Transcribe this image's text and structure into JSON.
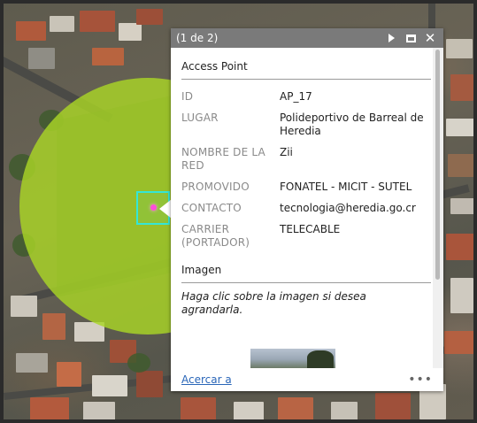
{
  "popup": {
    "count_label": "(1 de 2)",
    "layer_title": "Access Point",
    "fields": [
      {
        "key": "ID",
        "value": "AP_17"
      },
      {
        "key": "LUGAR",
        "value": "Polideportivo de Barreal de Heredia"
      },
      {
        "key": "NOMBRE DE LA RED",
        "value": "Zii"
      },
      {
        "key": "PROMOVIDO",
        "value": "FONATEL - MICIT - SUTEL"
      },
      {
        "key": "CONTACTO",
        "value": "tecnologia@heredia.go.cr"
      },
      {
        "key": "CARRIER (PORTADOR)",
        "value": "TELECABLE"
      }
    ],
    "image_section_title": "Imagen",
    "image_caption": "Haga clic sobre la imagen si desea agrandarla.",
    "zoom_link": "Acercar a",
    "more_label": "•••"
  },
  "icons": {
    "next": "play-triangle-icon",
    "maximize": "maximize-icon",
    "close": "close-icon",
    "more": "ellipsis-icon"
  },
  "colors": {
    "buffer_fill": "#aad626",
    "highlight": "#34e6d6",
    "point": "#ff4fd8",
    "header": "#7a7a7a",
    "link": "#2a66b8"
  }
}
